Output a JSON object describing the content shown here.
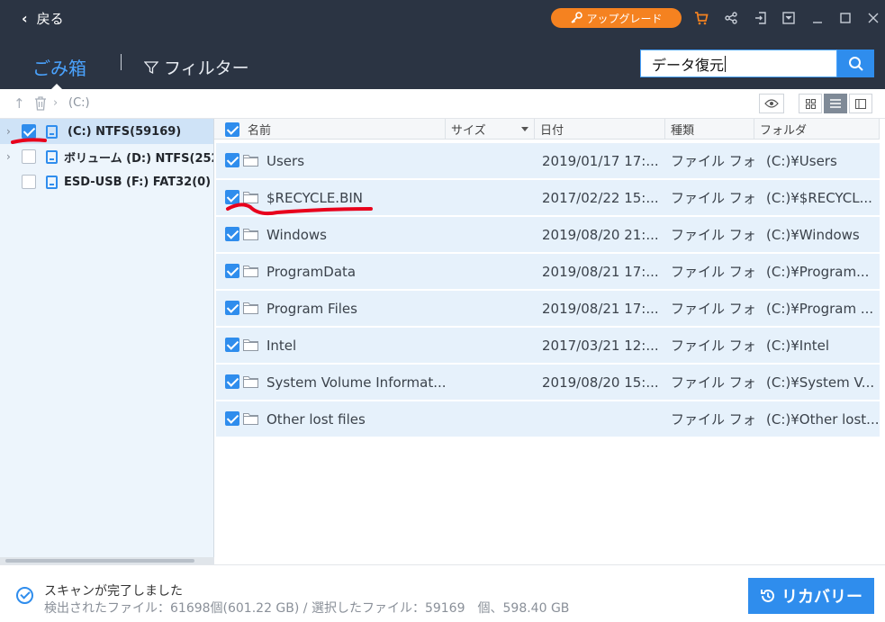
{
  "topbar": {
    "back_label": "戻る",
    "upgrade_label": "アップグレード",
    "icons": [
      "key-icon",
      "cart-icon",
      "share-icon",
      "login-icon",
      "menu-icon",
      "minimize-icon",
      "maximize-icon",
      "close-icon"
    ]
  },
  "header": {
    "trash_tab": "ごみ箱",
    "filter_label": "フィルター",
    "search_value": "データ復元"
  },
  "breadcrumb": {
    "path": "(C:)"
  },
  "drives": [
    {
      "label": "(C:) NTFS(59169)",
      "checked": true,
      "selected": true,
      "expandable": true
    },
    {
      "label": "ボリューム (D:) NTFS(252",
      "checked": false,
      "selected": false,
      "expandable": true
    },
    {
      "label": "ESD-USB (F:) FAT32(0)",
      "checked": false,
      "selected": false,
      "expandable": false
    }
  ],
  "table": {
    "columns": [
      "名前",
      "サイズ",
      "日付",
      "種類",
      "フォルダ"
    ],
    "rows": [
      {
        "name": "Users",
        "size": "",
        "date": "2019/01/17 17:...",
        "type": "ファイル フォ...",
        "folder": "(C:)¥Users"
      },
      {
        "name": "$RECYCLE.BIN",
        "size": "",
        "date": "2017/02/22 15:...",
        "type": "ファイル フォ...",
        "folder": "(C:)¥$RECYCL..."
      },
      {
        "name": "Windows",
        "size": "",
        "date": "2019/08/20 21:...",
        "type": "ファイル フォ...",
        "folder": "(C:)¥Windows"
      },
      {
        "name": "ProgramData",
        "size": "",
        "date": "2019/08/21 17:...",
        "type": "ファイル フォ...",
        "folder": "(C:)¥Program..."
      },
      {
        "name": "Program Files",
        "size": "",
        "date": "2019/08/21 17:...",
        "type": "ファイル フォ...",
        "folder": "(C:)¥Program ..."
      },
      {
        "name": "Intel",
        "size": "",
        "date": "2017/03/21 12:...",
        "type": "ファイル フォ...",
        "folder": "(C:)¥Intel"
      },
      {
        "name": "System Volume Informat...",
        "size": "",
        "date": "2019/08/20 15:...",
        "type": "ファイル フォ...",
        "folder": "(C:)¥System V..."
      },
      {
        "name": "Other lost files",
        "size": "",
        "date": "",
        "type": "ファイル フォ...",
        "folder": "(C:)¥Other lost..."
      }
    ]
  },
  "footer": {
    "status": "スキャンが完了しました",
    "stats": "検出されたファイル：61698個(601.22 GB) / 選択したファイル：59169　個、598.40 GB",
    "recover_label": "リカバリー"
  },
  "colors": {
    "header_bg": "#2b3443",
    "accent": "#2f8ded",
    "upgrade": "#f58220",
    "row_bg": "#e6f1fb",
    "annotation": "#e8001c"
  }
}
